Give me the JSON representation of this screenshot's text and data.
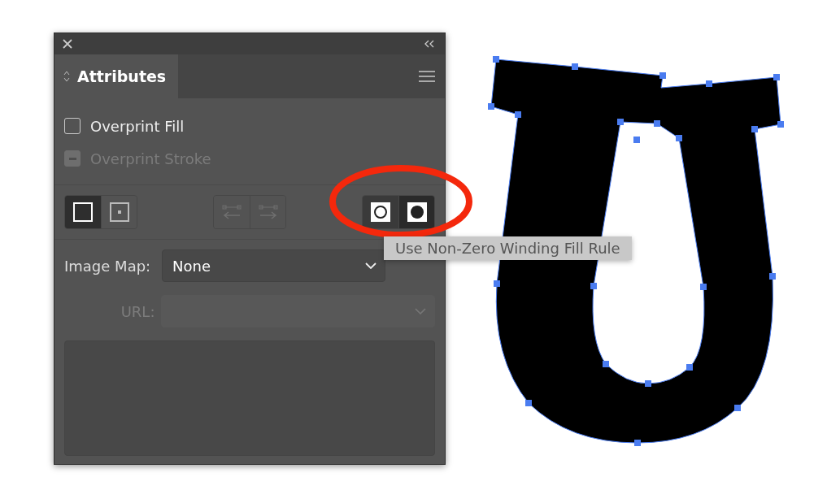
{
  "panel": {
    "tab_title": "Attributes"
  },
  "checkboxes": [
    {
      "label": "Overprint Fill",
      "checked": false,
      "disabled": false
    },
    {
      "label": "Overprint Stroke",
      "checked": false,
      "disabled": true
    }
  ],
  "shape_buttons": [
    {
      "kind": "square",
      "selected": true
    },
    {
      "kind": "center",
      "selected": false
    }
  ],
  "direction_buttons": [
    {
      "kind": "left",
      "disabled": true
    },
    {
      "kind": "right",
      "disabled": true
    }
  ],
  "fill_rule_buttons": [
    {
      "kind": "hollow",
      "selected": false
    },
    {
      "kind": "solid",
      "selected": true
    }
  ],
  "image_map": {
    "label": "Image Map:",
    "value": "None"
  },
  "url": {
    "label": "URL:",
    "disabled": true
  },
  "tooltip": "Use Non-Zero Winding Fill Rule"
}
